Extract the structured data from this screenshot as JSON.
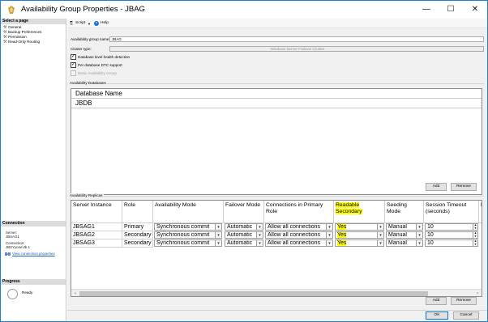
{
  "window": {
    "title": "Availability Group Properties - JBAG"
  },
  "titlebar_buttons": {
    "minimize": "—",
    "maximize": "☐",
    "close": "✕"
  },
  "sidebar": {
    "select_page_header": "Select a page",
    "pages": [
      {
        "label": "General"
      },
      {
        "label": "Backup Preferences"
      },
      {
        "label": "Permission"
      },
      {
        "label": "Read-Only Routing"
      }
    ],
    "connection_header": "Connection",
    "server_label": "Server:",
    "server_value": "JBSAG1",
    "connection_label": "Connection:",
    "connection_value": "JBSYyone\\Jb.1",
    "view_connection_link": "View connection properties",
    "progress_header": "Progress",
    "progress_status": "Ready"
  },
  "toolbar": {
    "script_label": "Script",
    "script_arrow": "▼",
    "help_label": "Help"
  },
  "general": {
    "ag_name_label": "Availability group name:",
    "ag_name_value": "JBAG",
    "cluster_type_label": "Cluster type:",
    "cluster_type_value": "Windows Server Failover Cluster",
    "db_health_label": "Database level health detection",
    "db_health_checked": true,
    "dtc_label": "Per database DTC support",
    "dtc_checked": true,
    "basic_label": "Basic Availability Group",
    "basic_checked": false
  },
  "availability_databases": {
    "group_label": "Availability Databases",
    "column_header": "Database Name",
    "rows": [
      "JBDB"
    ],
    "add_label": "Add",
    "remove_label": "Remove"
  },
  "replicas": {
    "group_label": "Availability Replicas",
    "columns": [
      "Server Instance",
      "Role",
      "Availability Mode",
      "Failover Mode",
      "Connections in Primary Role",
      "Readable Secondary",
      "Seeding Mode",
      "Session Timeout (seconds)",
      "E"
    ],
    "rows": [
      {
        "server": "JBSAG1",
        "role": "Primary",
        "mode": "Synchronous commit",
        "failover": "Automatic",
        "primary_conn": "Allow all connections",
        "readable": "Yes",
        "seeding": "Manual",
        "timeout": "10"
      },
      {
        "server": "JBSAG2",
        "role": "Secondary",
        "mode": "Synchronous commit",
        "failover": "Automatic",
        "primary_conn": "Allow all connections",
        "readable": "Yes",
        "seeding": "Manual",
        "timeout": "10"
      },
      {
        "server": "JBSAG3",
        "role": "Secondary",
        "mode": "Synchronous commit",
        "failover": "Automatic",
        "primary_conn": "Allow all connections",
        "readable": "Yes",
        "seeding": "Manual",
        "timeout": "10"
      }
    ],
    "add_label": "Add",
    "remove_label": "Remove",
    "highlight_color": "#ffff00"
  },
  "dialog_buttons": {
    "ok_label": "OK",
    "cancel_label": "Cancel"
  },
  "colors": {
    "window_border": "#1883d7",
    "link": "#1a5fb4",
    "section_header": "#dcdcdc"
  },
  "icons": {
    "app": "sql-server-icon",
    "page": "wrench-icon",
    "script": "script-icon",
    "help": "help-icon",
    "connection": "connection-icon",
    "progress": "progress-icon"
  }
}
